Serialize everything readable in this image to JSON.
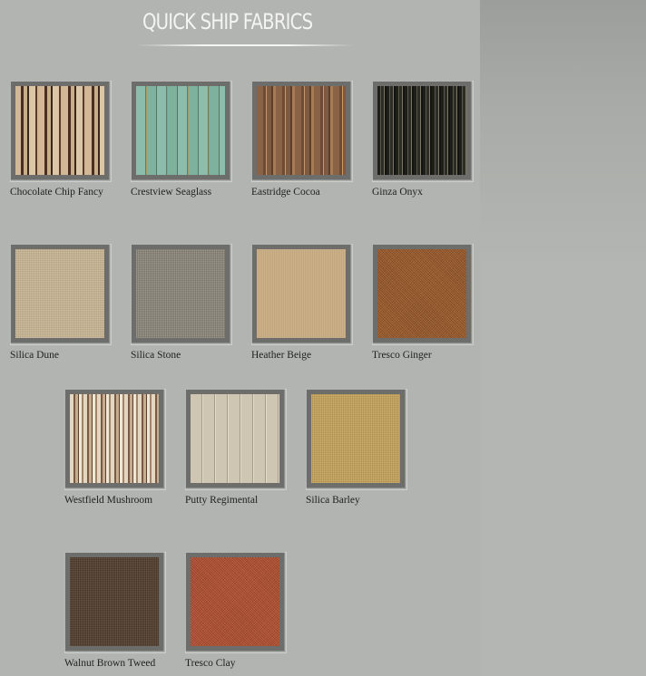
{
  "page": {
    "title": "QUICK SHIP FABRICS"
  },
  "fabrics": [
    {
      "name": "Chocolate Chip Fancy",
      "texture": "chocolate-chip-fancy-stripe",
      "color": "#d2b896"
    },
    {
      "name": "Crestview Seaglass",
      "texture": "crestview-seaglass-stripe",
      "color": "#8cbcab"
    },
    {
      "name": "Eastridge Cocoa",
      "texture": "eastridge-cocoa-stripe",
      "color": "#8a6346"
    },
    {
      "name": "Ginza Onyx",
      "texture": "ginza-onyx-stripe",
      "color": "#1e1f1b"
    },
    {
      "name": "Silica Dune",
      "texture": "silica-dune-solid",
      "color": "#c7b491"
    },
    {
      "name": "Silica Stone",
      "texture": "silica-stone-solid",
      "color": "#8a8679"
    },
    {
      "name": "Heather Beige",
      "texture": "heather-beige-solid",
      "color": "#c8ac82"
    },
    {
      "name": "Tresco Ginger",
      "texture": "tresco-ginger-solid",
      "color": "#96582c"
    },
    {
      "name": "Westfield Mushroom",
      "texture": "westfield-mushroom-stripe",
      "color": "#e4d7c2"
    },
    {
      "name": "Putty Regimental",
      "texture": "putty-regimental-stripe",
      "color": "#cfc5b3"
    },
    {
      "name": "Silica Barley",
      "texture": "silica-barley-solid",
      "color": "#c4a258"
    },
    {
      "name": "Walnut Brown Tweed",
      "texture": "walnut-brown-tweed-solid",
      "color": "#54402e"
    },
    {
      "name": "Tresco Clay",
      "texture": "tresco-clay-solid",
      "color": "#b04f32"
    }
  ]
}
